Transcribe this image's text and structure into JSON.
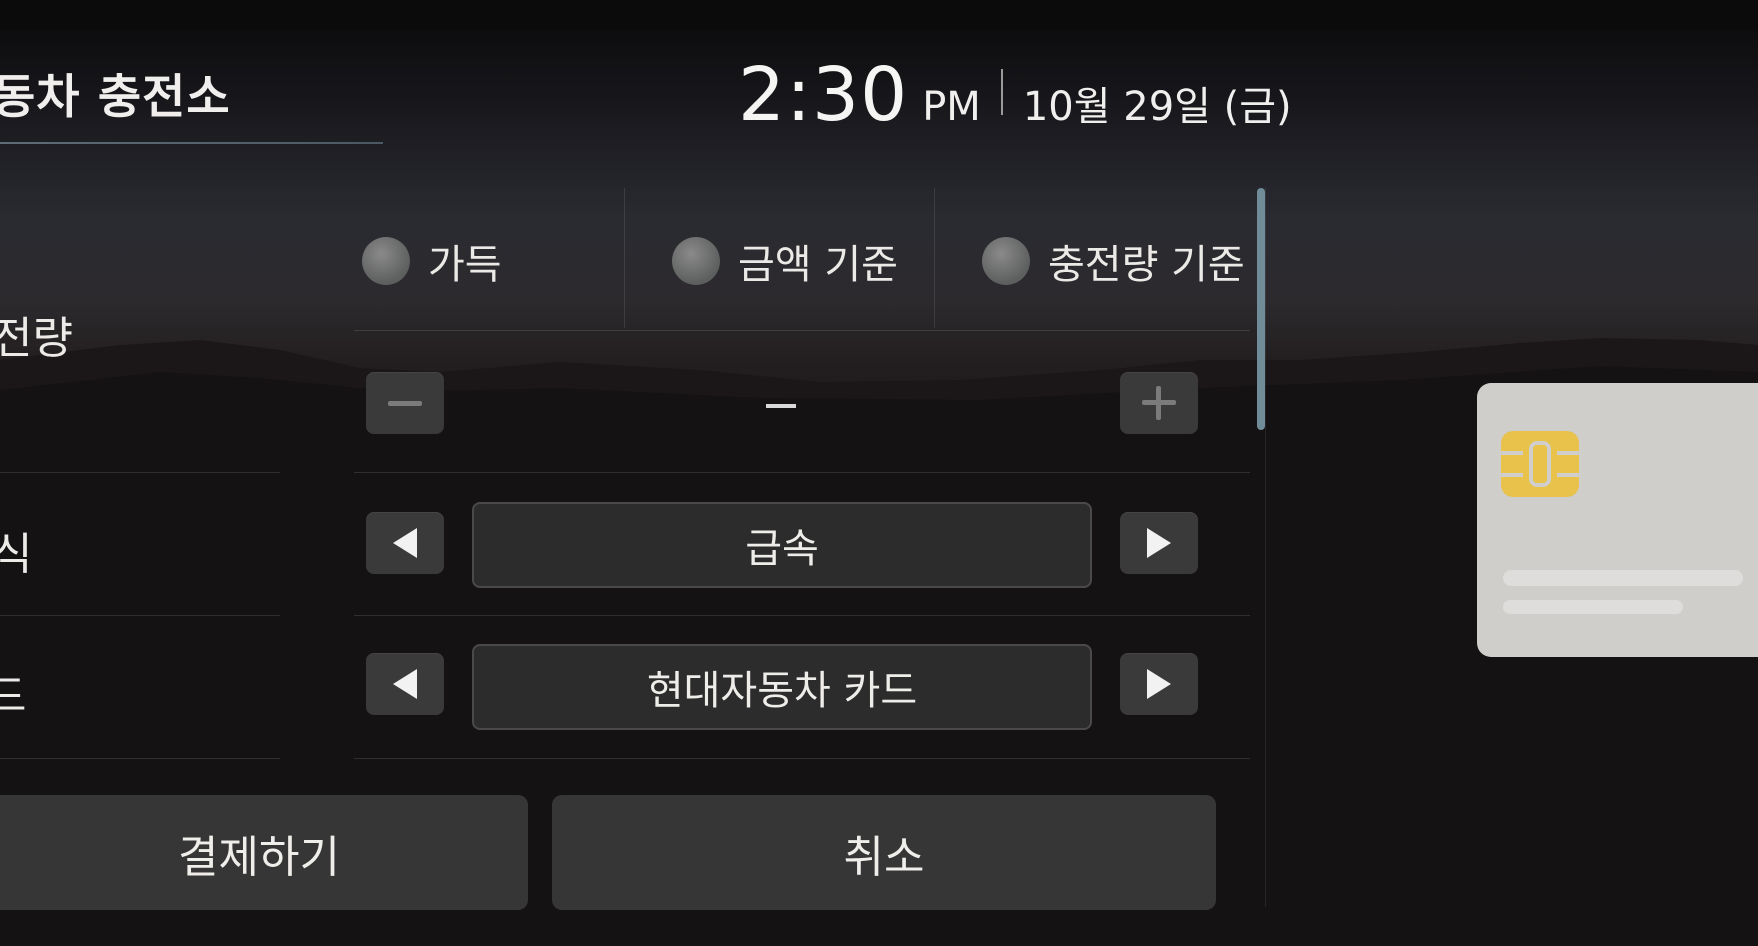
{
  "header": {
    "title": "동차 충전소",
    "time": "2:30",
    "ampm": "PM",
    "date": "10월 29일 (금)"
  },
  "rows": {
    "charge_amount_label": "전량",
    "charge_type_label": "식",
    "card_label": "드"
  },
  "charge_options": [
    {
      "label": "가득",
      "selected": false
    },
    {
      "label": "금액 기준",
      "selected": false
    },
    {
      "label": "충전량 기준",
      "selected": false
    }
  ],
  "amount": {
    "value": "–",
    "minus_icon": "minus-icon",
    "plus_icon": "plus-icon"
  },
  "charge_type": {
    "value": "급속"
  },
  "payment_card": {
    "value": "현대자동차 카드"
  },
  "actions": {
    "pay_label": "결제하기",
    "cancel_label": "취소"
  },
  "colors": {
    "accent_scroll": "#6f8c98",
    "card_chip": "#e8c24a",
    "card_body": "#cfcecb"
  },
  "icons": {
    "left_arrow": "triangle-left-icon",
    "right_arrow": "triangle-right-icon",
    "card": "credit-card-icon"
  }
}
